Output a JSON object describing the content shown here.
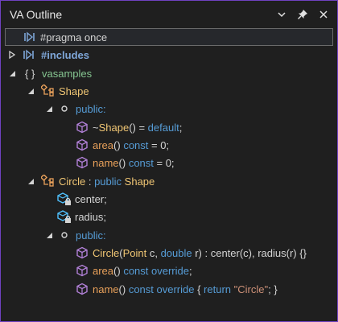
{
  "window": {
    "title": "VA Outline"
  },
  "icons": {
    "dropdown": "chevron-down-icon",
    "pin": "pin-icon",
    "close": "close-icon"
  },
  "rows": {
    "pragma": {
      "text": "#pragma once"
    },
    "includes": {
      "text": "#includes"
    },
    "namespace": {
      "text": "vasamples",
      "braces": "{ }"
    },
    "shape": {
      "name": "Shape"
    },
    "shape_public": {
      "text": "public:"
    },
    "shape_dtor": {
      "tilde": "~",
      "name": "Shape",
      "rest1": "() = ",
      "kw": "default",
      "rest2": ";"
    },
    "shape_area": {
      "name": "area",
      "rest1": "() ",
      "kw": "const",
      "rest2": " = 0;"
    },
    "shape_name": {
      "name": "name",
      "rest1": "() ",
      "kw": "const",
      "rest2": " = 0;"
    },
    "circle": {
      "name": "Circle",
      "sep": " : ",
      "kw": "public",
      "base": "Shape"
    },
    "circle_center": {
      "text": "center;"
    },
    "circle_radius": {
      "text": "radius;"
    },
    "circle_public": {
      "text": "public:"
    },
    "circle_ctor": {
      "name": "Circle",
      "p1": "(",
      "t1": "Point",
      "p2": " c, ",
      "t2": "double",
      "p3": " r) : center(c), radius(r) {}"
    },
    "circle_area": {
      "name": "area",
      "rest1": "() ",
      "kw": "const override",
      "rest2": ";"
    },
    "circle_name": {
      "name": "name",
      "rest1": "() ",
      "kw1": "const override",
      "rest2": " { ",
      "kw2": "return",
      "rest3": " ",
      "str": "\"Circle\"",
      "rest4": "; }"
    }
  }
}
